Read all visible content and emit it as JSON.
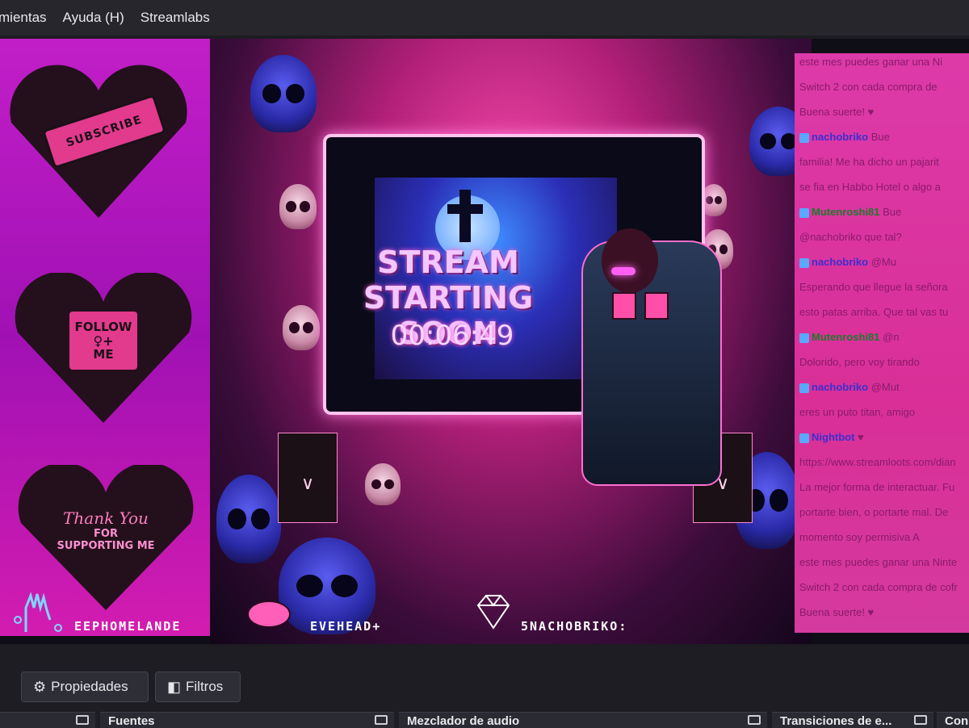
{
  "menubar": {
    "items": [
      "mientas",
      "Ayuda (H)",
      "Streamlabs"
    ]
  },
  "overlay": {
    "subscribe_label": "SUBSCRIBE",
    "follow_lines": [
      "FOLLOW",
      "ME"
    ],
    "thanks_script": "Thank You",
    "thanks_bold": [
      "FOR",
      "SUPPORTING ME"
    ],
    "stream_title": [
      "STREAM",
      "STARTING SOON"
    ],
    "countdown": "00:06:49",
    "left_handle": "EEPHOMELANDE",
    "mid_handle": "EVEHEAD+",
    "right_handle": "5NACHOBRIKO:"
  },
  "chat": {
    "lines": [
      {
        "text": "este mes puedes ganar una Ni"
      },
      {
        "text": "Switch 2 con cada compra de"
      },
      {
        "text": "Buena suerte! ♥"
      },
      {
        "user": "nachobriko",
        "user_class": "u-blue",
        "text": " Bue"
      },
      {
        "text": "familia! Me ha dicho un pajarit"
      },
      {
        "text": "se fia en Habbo Hotel o algo a"
      },
      {
        "user": "Mutenroshi81",
        "user_class": "u-green",
        "text": " Bue"
      },
      {
        "text": "@nachobriko que tal?"
      },
      {
        "user": "nachobriko",
        "user_class": "u-blue",
        "text": " @Mu"
      },
      {
        "text": "Esperando que llegue la señora"
      },
      {
        "text": "esto patas arriba. Que tal vas tu"
      },
      {
        "user": "Mutenroshi81",
        "user_class": "u-green",
        "text": " @n"
      },
      {
        "text": "Dolorido, pero voy tirando"
      },
      {
        "user": "nachobriko",
        "user_class": "u-blue",
        "text": " @Mut"
      },
      {
        "text": "eres un puto titan, amigo"
      },
      {
        "user": "Nightbot",
        "user_class": "u-blue",
        "text": " ♥"
      },
      {
        "text": "https://www.streamloots.com/dian"
      },
      {
        "text": "La mejor forma de interactuar. Fu"
      },
      {
        "text": "portarte bien, o portarte mal. De"
      },
      {
        "text": "momento soy permisiva  A"
      },
      {
        "text": "este mes puedes ganar una Ninte"
      },
      {
        "text": "Switch 2 con cada compra de cofr"
      },
      {
        "text": "Buena suerte! ♥"
      }
    ]
  },
  "controls": {
    "properties_label": "Propiedades",
    "filters_label": "Filtros"
  },
  "docks": [
    "",
    "Fuentes",
    "Mezclador de audio",
    "Transiciones de e...",
    "Con"
  ],
  "colors": {
    "accent_pink": "#d8325f",
    "overlay_magenta": "#c21ec8",
    "chat_bg": "#dd3aa9"
  }
}
